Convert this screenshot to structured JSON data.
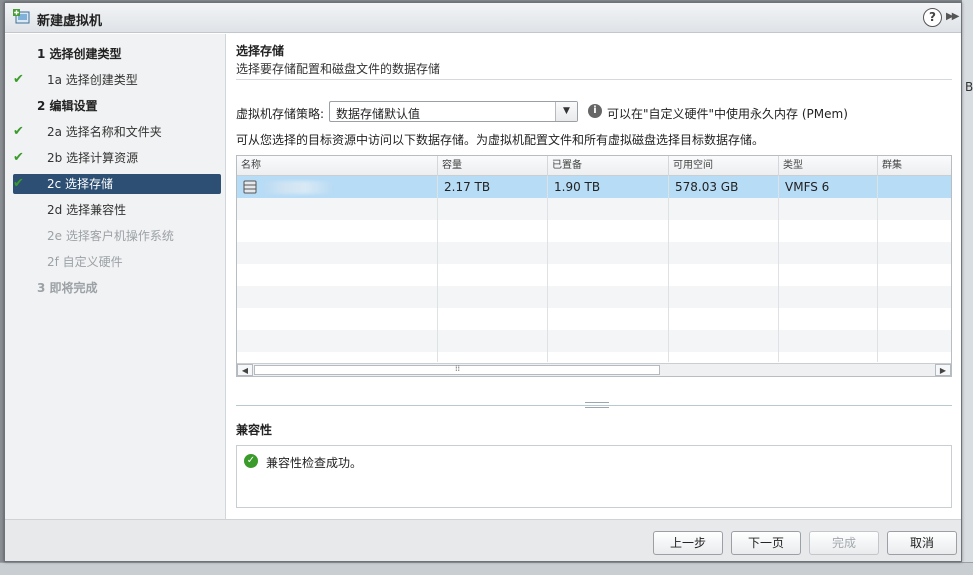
{
  "dialog": {
    "title": "新建虚拟机",
    "help_icon": "?",
    "expand_icon": "▶▶"
  },
  "nav": {
    "items": [
      {
        "label": "1  选择创建类型",
        "kind": "step",
        "checked": false,
        "state": "normal"
      },
      {
        "label": "1a  选择创建类型",
        "kind": "sub",
        "checked": true,
        "state": "normal"
      },
      {
        "label": "2  编辑设置",
        "kind": "step",
        "checked": false,
        "state": "normal"
      },
      {
        "label": "2a  选择名称和文件夹",
        "kind": "sub",
        "checked": true,
        "state": "normal"
      },
      {
        "label": "2b  选择计算资源",
        "kind": "sub",
        "checked": true,
        "state": "normal"
      },
      {
        "label": "2c  选择存储",
        "kind": "sub",
        "checked": true,
        "state": "active"
      },
      {
        "label": "2d  选择兼容性",
        "kind": "sub",
        "checked": false,
        "state": "normal"
      },
      {
        "label": "2e  选择客户机操作系统",
        "kind": "sub",
        "checked": false,
        "state": "disabled"
      },
      {
        "label": "2f  自定义硬件",
        "kind": "sub",
        "checked": false,
        "state": "disabled"
      },
      {
        "label": "3  即将完成",
        "kind": "step",
        "checked": false,
        "state": "disabled"
      }
    ],
    "check_glyph": "✔"
  },
  "main": {
    "title": "选择存储",
    "description": "选择要存储配置和磁盘文件的数据存储",
    "policy_label": "虚拟机存储策略:",
    "policy_value": "数据存储默认值",
    "info_text": "可以在\"自定义硬件\"中使用永久内存 (PMem)",
    "access_note": "可从您选择的目标资源中访问以下数据存储。为虚拟机配置文件和所有虚拟磁盘选择目标数据存储。",
    "table": {
      "columns": [
        "名称",
        "容量",
        "已置备",
        "可用空间",
        "类型",
        "群集"
      ],
      "rows": [
        {
          "name": "",
          "capacity": "2.17 TB",
          "provisioned": "1.90 TB",
          "free": "578.03 GB",
          "type": "VMFS 6",
          "cluster": ""
        }
      ]
    },
    "compat_title": "兼容性",
    "compat_message": "兼容性检查成功。"
  },
  "footer": {
    "back": "上一步",
    "next": "下一页",
    "finish": "完成",
    "cancel": "取消"
  },
  "background": {
    "letter": "B"
  },
  "colors": {
    "nav_active": "#2d4f73",
    "row_selected": "#b7dcf6",
    "check_green": "#3a9b2a"
  }
}
